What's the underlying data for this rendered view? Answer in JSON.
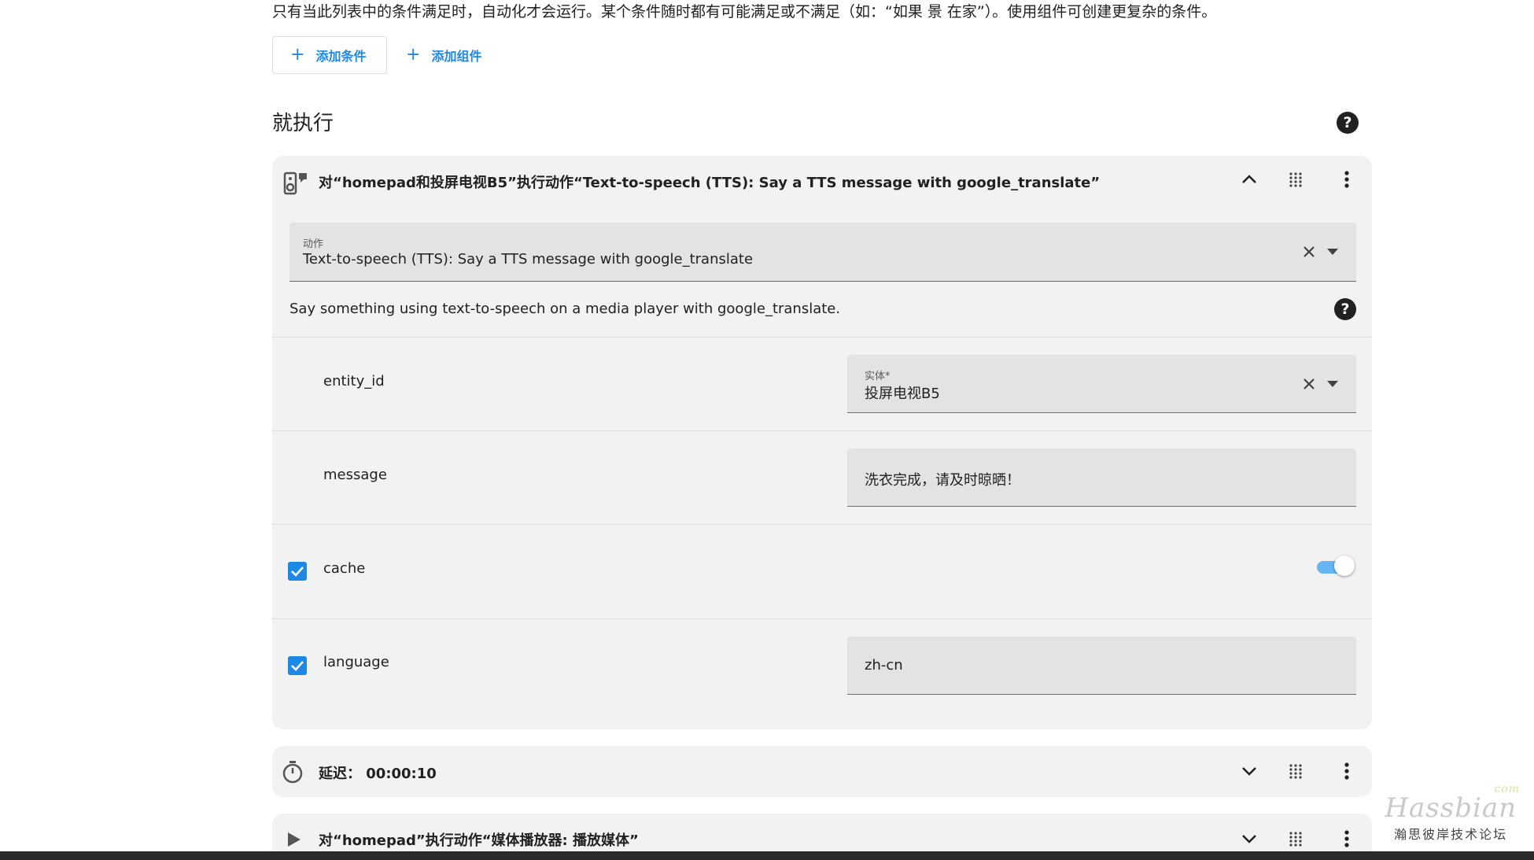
{
  "conditions": {
    "description": "只有当此列表中的条件满足时，自动化才会运行。某个条件随时都有可能满足或不满足（如：“如果 景 在家”）。使用组件可创建更复杂的条件。",
    "add_condition_label": "添加条件",
    "add_building_block_label": "添加组件"
  },
  "actions": {
    "title": "就执行",
    "tts_card": {
      "title": "对“homepad和投屏电视B5”执行动作“Text-to-speech (TTS): Say a TTS message with google_translate”",
      "action_field": {
        "label": "动作",
        "value": "Text-to-speech (TTS): Say a TTS message with google_translate"
      },
      "description": "Say something using text-to-speech on a media player with google_translate.",
      "rows": {
        "entity": {
          "label": "entity_id",
          "field_label": "实体*",
          "value": "投屏电视B5"
        },
        "message": {
          "label": "message",
          "value": "洗衣完成，请及时晾晒！"
        },
        "cache": {
          "label": "cache",
          "checked": true,
          "toggle_on": true
        },
        "language": {
          "label": "language",
          "checked": true,
          "value": "zh-cn"
        }
      }
    },
    "delay_card": {
      "title": "延迟： 00:00:10"
    },
    "media_card": {
      "title": "对“homepad”执行动作“媒体播放器: 播放媒体”"
    }
  },
  "watermark": {
    "logo": "Hassbian",
    "com": "com",
    "subtitle": "瀚思彼岸技术论坛"
  },
  "colors": {
    "accent": "#1e88e5",
    "card_bg": "#f2f2f2",
    "field_bg": "#e3e3e3"
  }
}
